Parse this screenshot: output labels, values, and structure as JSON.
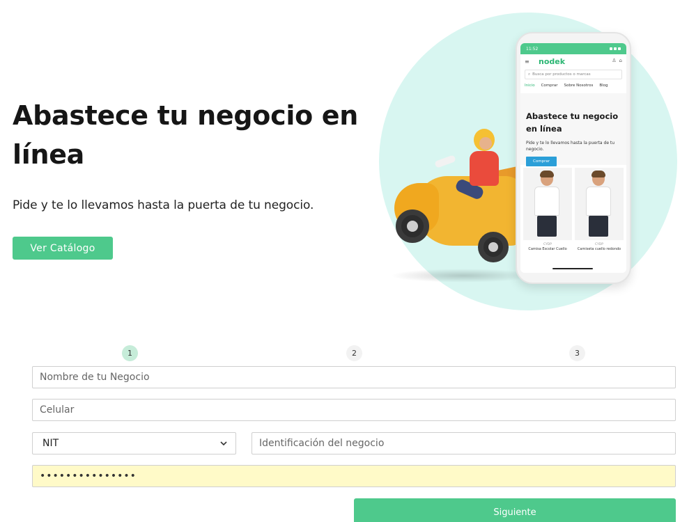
{
  "hero": {
    "title": "Abastece tu negocio en línea",
    "subtitle": "Pide y te lo llevamos hasta la puerta de tu negocio.",
    "catalog_button": "Ver Catálogo"
  },
  "phone_mockup": {
    "time": "11:52",
    "brand": "nodek",
    "search_placeholder": "Busca por productos o marcas",
    "nav": [
      "Inicio",
      "Comprar",
      "Sobre Nosotros",
      "Blog"
    ],
    "title": "Abastece tu negocio en línea",
    "subtitle": "Pide y te lo llevamos hasta la puerta de tu negocio.",
    "button": "Comprar",
    "products": [
      {
        "brand": "CYDP",
        "name": "Camisa Escolar Cuello"
      },
      {
        "brand": "CYDP",
        "name": "Camiseta cuello redondo"
      }
    ]
  },
  "steps": [
    "1",
    "2",
    "3"
  ],
  "form": {
    "business_name_placeholder": "Nombre de tu Negocio",
    "phone_placeholder": "Celular",
    "id_type_selected": "NIT",
    "id_placeholder": "Identificación del negocio",
    "password_value": "•••••••••••••••",
    "next_button": "Siguiente"
  },
  "colors": {
    "accent": "#4ec98c",
    "circle": "#d8f6f1",
    "autofill": "#fffac8"
  }
}
